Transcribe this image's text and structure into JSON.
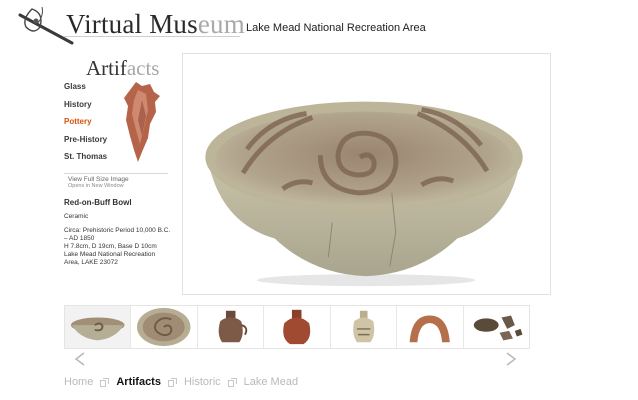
{
  "header": {
    "title_main": "Virtual Mus",
    "title_fade": "eum",
    "subtitle": "Lake Mead National Recreation Area"
  },
  "sidebar": {
    "section_main": "Artif",
    "section_fade": "acts",
    "nav_items": [
      {
        "label": "Glass",
        "active": false
      },
      {
        "label": "History",
        "active": false
      },
      {
        "label": "Pottery",
        "active": true
      },
      {
        "label": "Pre-History",
        "active": false
      },
      {
        "label": "St. Thomas",
        "active": false
      }
    ],
    "view_full_size": "View Full Size Image",
    "opens_new_window": "Opens in New Window"
  },
  "artifact": {
    "name": "Red-on-Buff Bowl",
    "material": "Ceramic",
    "description": "Circa: Prehistoric Period 10,000 B.C. – AD 1850\nH 7.8cm, D 19cm, Base D 10cm\nLake Mead National Recreation Area, LAKE 23072"
  },
  "thumbnails": [
    {
      "name": "thumb-bowl-side",
      "selected": true
    },
    {
      "name": "thumb-bowl-top",
      "selected": false
    },
    {
      "name": "thumb-jar-dark",
      "selected": false
    },
    {
      "name": "thumb-jar-red",
      "selected": false
    },
    {
      "name": "thumb-jar-light",
      "selected": false
    },
    {
      "name": "thumb-arc-fragment",
      "selected": false
    },
    {
      "name": "thumb-fragments",
      "selected": false
    }
  ],
  "breadcrumb": [
    {
      "label": "Home",
      "current": false
    },
    {
      "label": "Artifacts",
      "current": true
    },
    {
      "label": "Historic",
      "current": false
    },
    {
      "label": "Lake Mead",
      "current": false
    }
  ],
  "colors": {
    "accent": "#d55410",
    "bowl": "#b9b29a",
    "bowl_dark": "#8a7560"
  },
  "icons": [
    "museum-logo-icon",
    "arrowhead-artifact-icon",
    "chevron-left-icon",
    "chevron-right-icon",
    "breadcrumb-separator-icon"
  ]
}
